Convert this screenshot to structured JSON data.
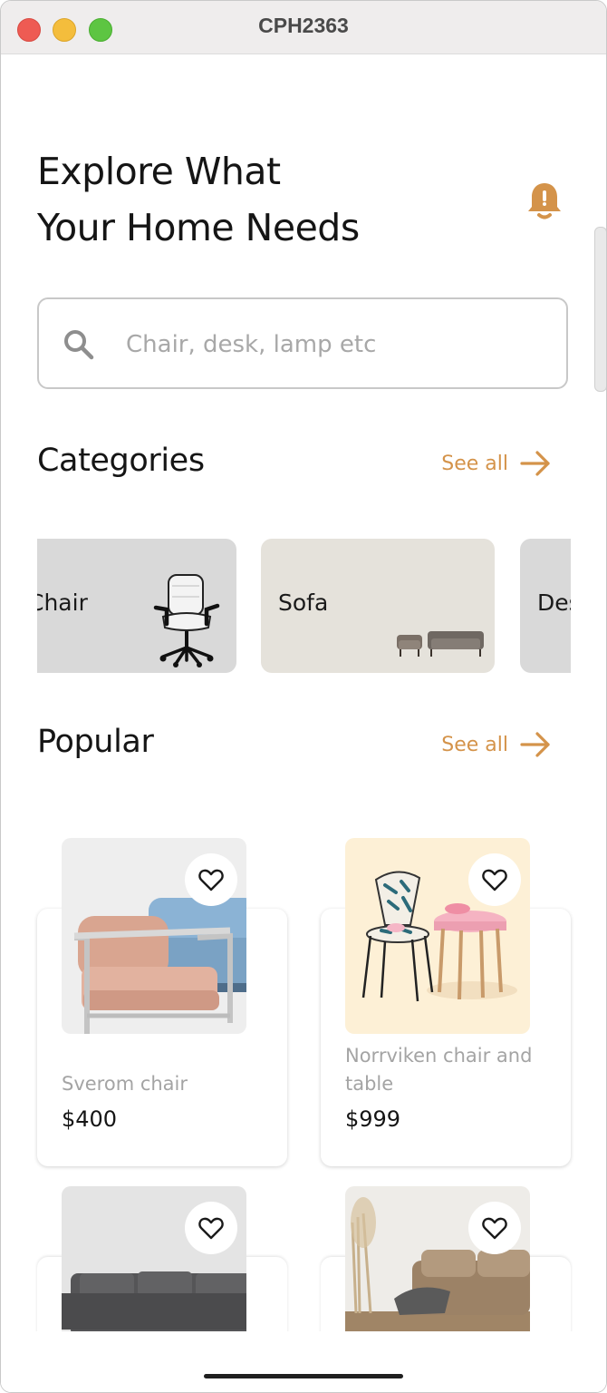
{
  "window": {
    "title": "CPH2363"
  },
  "header": {
    "title_line1": "Explore What",
    "title_line2": "Your Home Needs",
    "icon": "bell-icon"
  },
  "search": {
    "placeholder": "Chair, desk, lamp etc",
    "value": "",
    "icon": "search-icon"
  },
  "categories": {
    "title": "Categories",
    "see_all": "See all",
    "items": [
      {
        "label": "Chair"
      },
      {
        "label": "Sofa"
      },
      {
        "label": "Desk"
      }
    ]
  },
  "popular": {
    "title": "Popular",
    "see_all": "See all",
    "products": [
      {
        "name": "Sverom chair",
        "price": "$400"
      },
      {
        "name": "Norrviken chair and table",
        "price": "$999"
      },
      {
        "name": "",
        "price": ""
      },
      {
        "name": "",
        "price": ""
      }
    ]
  },
  "colors": {
    "accent": "#d4934a",
    "text": "#151515",
    "muted": "#a4a4a4"
  }
}
